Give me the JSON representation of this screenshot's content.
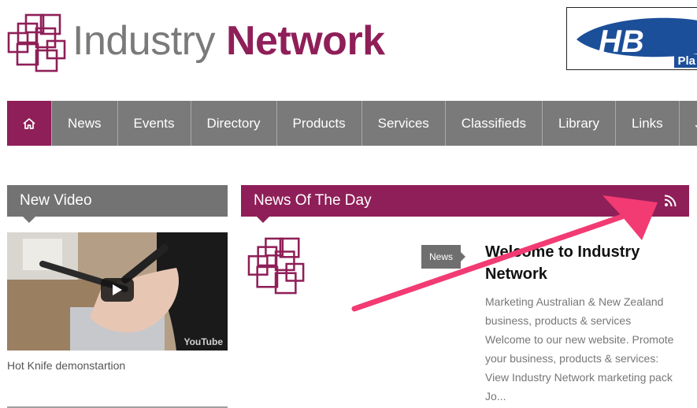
{
  "brand": {
    "name_part1": "Industry",
    "name_part2": "Network",
    "accent": "#8f1f58",
    "grey": "#7a7a7a"
  },
  "banner": {
    "text": "Pla"
  },
  "nav": {
    "home_icon": "home-icon",
    "items": [
      "News",
      "Events",
      "Directory",
      "Products",
      "Services",
      "Classifieds",
      "Library",
      "Links",
      "Join"
    ]
  },
  "video_panel": {
    "title": "New Video",
    "caption": "Hot Knife demonstartion",
    "watermark": "YouTube"
  },
  "news_panel": {
    "title": "News Of The Day",
    "rss_icon": "rss-icon",
    "tag": "News",
    "article_title": "Welcome to Industry Network",
    "article_excerpt": "Marketing Australian & New Zealand business, products & services Welcome to our new website. Promote your business, products & services: View Industry Network marketing pack Jo..."
  }
}
